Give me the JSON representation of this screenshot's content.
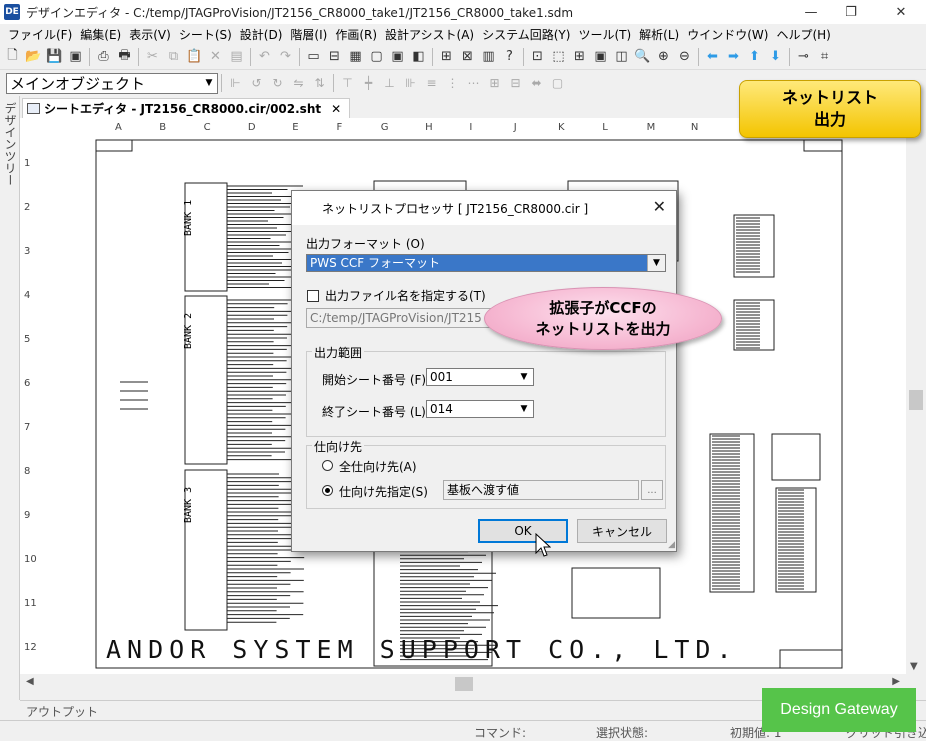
{
  "window": {
    "title": "デザインエディタ - C:/temp/JTAGProVision/JT2156_CR8000_take1/JT2156_CR8000_take1.sdm",
    "app_icon": "DE",
    "controls": {
      "minimize": "—",
      "restore": "❐",
      "close": "✕"
    }
  },
  "menu": [
    "ファイル(F)",
    "編集(E)",
    "表示(V)",
    "シート(S)",
    "設計(D)",
    "階層(I)",
    "作画(R)",
    "設計アシスト(A)",
    "システム回路(Y)",
    "ツール(T)",
    "解析(L)",
    "ウインドウ(W)",
    "ヘルプ(H)"
  ],
  "toolbar": {
    "object_select": "メインオブジェクト"
  },
  "side_tab": "デザインツリー",
  "doc_tab": "シートエディタ - JT2156_CR8000.cir/002.sht",
  "sheet": {
    "columns": [
      "A",
      "B",
      "C",
      "D",
      "E",
      "F",
      "G",
      "H",
      "I",
      "J",
      "K",
      "L",
      "M",
      "N"
    ],
    "rows": [
      "1",
      "2",
      "3",
      "4",
      "5",
      "6",
      "7",
      "8",
      "9",
      "10",
      "11",
      "12"
    ],
    "bank_labels": [
      "BANK 1",
      "BANK 2",
      "BANK 3"
    ],
    "company_text": "ANDOR SYSTEM SUPPORT CO., LTD."
  },
  "callout_top": {
    "line1": "ネットリスト",
    "line2": "出力"
  },
  "dialog": {
    "title": "ネットリストプロセッサ [ JT2156_CR8000.cir ]",
    "close": "✕",
    "format_label": "出力フォーマット (O)",
    "format_value": "PWS CCF フォーマット",
    "filename_checkbox_label": "出力ファイル名を指定する(T)",
    "filename_checked": false,
    "path_value": "C:/temp/JTAGProVision/JT215",
    "range_group": "出力範囲",
    "start_label": "開始シート番号 (F)",
    "start_value": "001",
    "end_label": "終了シート番号 (L)",
    "end_value": "014",
    "dest_group": "仕向け先",
    "radio_all": "全仕向け先(A)",
    "radio_specified": "仕向け先指定(S)",
    "selected_radio": "specified",
    "dest_value": "基板へ渡す値",
    "browse": "...",
    "ok": "OK",
    "cancel": "キャンセル"
  },
  "callout_middle": {
    "line1": "拡張子がCCFの",
    "line2": "ネットリストを出力"
  },
  "output_tab": "アウトプット",
  "status": {
    "command": "コマンド:",
    "selection": "選択状態:",
    "initial": "初期値: 1",
    "grid": "グリッド引き込み"
  },
  "badge": "Design Gateway",
  "colors": {
    "callout_yellow": "#f3c400",
    "callout_pink": "#f6b8d2",
    "badge_green": "#56c44a",
    "selection_blue": "#3a77c8"
  }
}
